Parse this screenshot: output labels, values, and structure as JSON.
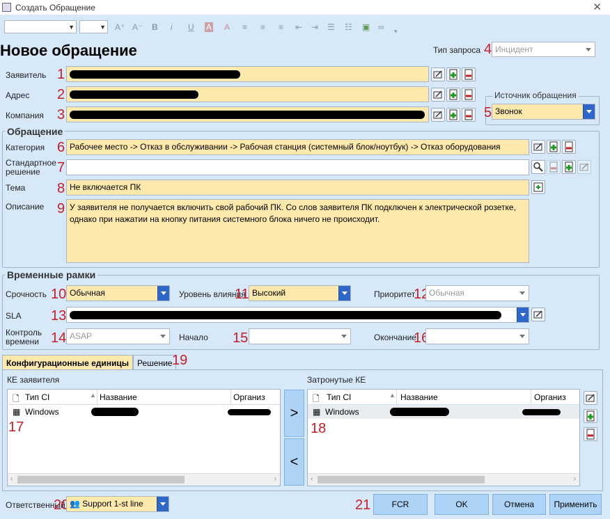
{
  "window": {
    "title": "Создать Обращение"
  },
  "page": {
    "heading": "Новое обращение"
  },
  "request_type": {
    "label": "Тип запроса",
    "value": "Инцидент"
  },
  "applicant": {
    "label": "Заявитель"
  },
  "address": {
    "label": "Адрес"
  },
  "company": {
    "label": "Компания"
  },
  "source": {
    "legend": "Источник обращения",
    "value": "Звонок"
  },
  "appeal": {
    "legend": "Обращение",
    "category_label": "Категория",
    "category_value": "Рабочее место -> Отказ в обслуживании -> Рабочая станция (системный блок/ноутбук) -> Отказ оборудования",
    "standard_label_1": "Стандартное",
    "standard_label_2": "решение",
    "standard_value": "",
    "subject_label": "Тема",
    "subject_value": "Не включается ПК",
    "desc_label": "Описание",
    "desc_line1": "У заявителя не получается включить свой рабочий ПК. Со слов заявителя ПК подключен к электрической розетке,",
    "desc_line2": "однако при нажатии на кнопку питания системного блока ничего не происходит."
  },
  "timeframe": {
    "legend": "Временные рамки",
    "urgency_label": "Срочность",
    "urgency_value": "Обычная",
    "impact_label": "Уровень влияния",
    "impact_value": "Высокий",
    "priority_label": "Приоритет",
    "priority_value": "Обычная",
    "sla_label": "SLA",
    "control_label_1": "Контроль",
    "control_label_2": "времени",
    "control_value": "ASAP",
    "start_label": "Начало",
    "start_value": "",
    "end_label": "Окончание",
    "end_value": ""
  },
  "tabs": {
    "ci": "Конфигурационные единицы",
    "solution": "Решение"
  },
  "ci": {
    "left_title": "КЕ заявителя",
    "right_title": "Затронутые КЕ",
    "col_type": "Тип CI",
    "col_name": "Название",
    "col_org": "Организ",
    "col_org_right": "Организ",
    "left_row_type": "Windows",
    "right_row_type": "Windows",
    "move_right": ">",
    "move_left": "<"
  },
  "responsible": {
    "label": "Ответственный",
    "value": "Support 1-st line"
  },
  "buttons": {
    "fcr": "FCR",
    "ok": "OK",
    "cancel": "Отмена",
    "apply": "Применить"
  },
  "annotations": {
    "n1": "1",
    "n2": "2",
    "n3": "3",
    "n4": "4",
    "n5": "5",
    "n6": "6",
    "n7": "7",
    "n8": "8",
    "n9": "9",
    "n10": "10",
    "n11": "11",
    "n12": "12",
    "n13": "13",
    "n14": "14",
    "n15": "15",
    "n16": "16",
    "n17": "17",
    "n18": "18",
    "n19": "19",
    "n20": "20",
    "n21": "21"
  },
  "colors": {
    "field": "#fde9ac",
    "background": "#d7e9f9",
    "accent": "#2e67c7",
    "annotation": "#c71d26"
  }
}
